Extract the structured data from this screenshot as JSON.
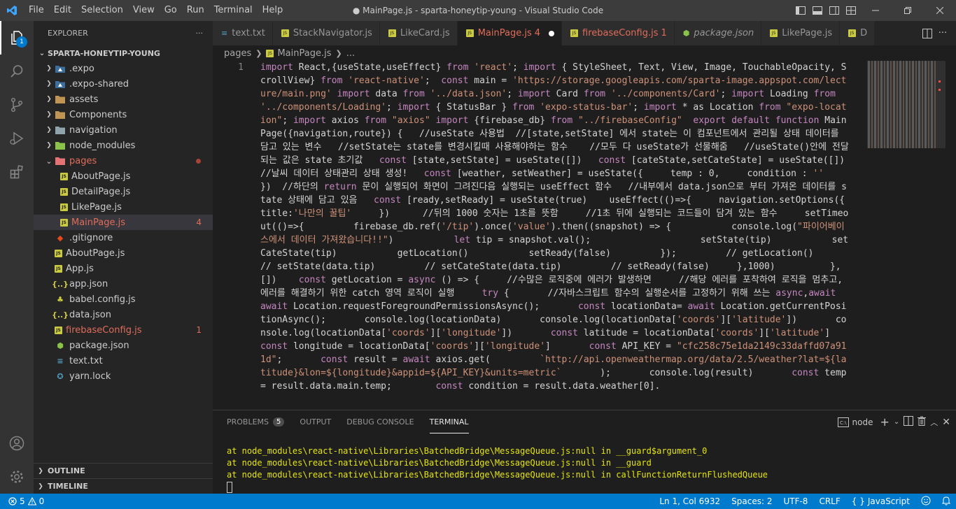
{
  "titlebar": {
    "menu": [
      "File",
      "Edit",
      "Selection",
      "View",
      "Go",
      "Run",
      "Terminal",
      "Help"
    ],
    "title": "● MainPage.js - sparta-honeytip-young - Visual Studio Code"
  },
  "activity": {
    "explorer_badge": "1"
  },
  "sidebar": {
    "header": "EXPLORER",
    "more": "···",
    "project": "SPARTA-HONEYTIP-YOUNG",
    "tree": [
      {
        "label": ".expo",
        "type": "folder",
        "depth": 1,
        "icon": "expo-folder-icon"
      },
      {
        "label": ".expo-shared",
        "type": "folder",
        "depth": 1,
        "icon": "expo-folder-icon"
      },
      {
        "label": "assets",
        "type": "folder",
        "depth": 1,
        "icon": "folder-icon"
      },
      {
        "label": "Components",
        "type": "folder",
        "depth": 1,
        "icon": "folder-icon"
      },
      {
        "label": "navigation",
        "type": "folder",
        "depth": 1,
        "icon": "folder-icon"
      },
      {
        "label": "node_modules",
        "type": "folder",
        "depth": 1,
        "icon": "folder-icon"
      },
      {
        "label": "pages",
        "type": "folder-open",
        "depth": 1,
        "icon": "folder-icon",
        "color": "#e06c5a",
        "dot": true
      },
      {
        "label": "AboutPage.js",
        "type": "js",
        "depth": 2
      },
      {
        "label": "DetailPage.js",
        "type": "js",
        "depth": 2
      },
      {
        "label": "LikePage.js",
        "type": "js",
        "depth": 2
      },
      {
        "label": "MainPage.js",
        "type": "js",
        "depth": 2,
        "color": "#e06c5a",
        "badge": "4",
        "selected": true
      },
      {
        "label": ".gitignore",
        "type": "git",
        "depth": 1
      },
      {
        "label": "AboutPage.js",
        "type": "js",
        "depth": 1
      },
      {
        "label": "App.js",
        "type": "js",
        "depth": 1
      },
      {
        "label": "app.json",
        "type": "json",
        "depth": 1
      },
      {
        "label": "babel.config.js",
        "type": "babel",
        "depth": 1
      },
      {
        "label": "data.json",
        "type": "json",
        "depth": 1
      },
      {
        "label": "firebaseConfig.js",
        "type": "js",
        "depth": 1,
        "color": "#e06c5a",
        "badge": "1"
      },
      {
        "label": "package.json",
        "type": "node",
        "depth": 1
      },
      {
        "label": "text.txt",
        "type": "txt",
        "depth": 1
      },
      {
        "label": "yarn.lock",
        "type": "yarn",
        "depth": 1
      }
    ],
    "outline": "OUTLINE",
    "timeline": "TIMELINE"
  },
  "tabs": [
    {
      "label": "text.txt",
      "icon": "txt",
      "suffix": ""
    },
    {
      "label": "StackNavigator.js",
      "icon": "js",
      "suffix": ""
    },
    {
      "label": "LikeCard.js",
      "icon": "js",
      "suffix": ""
    },
    {
      "label": "MainPage.js",
      "icon": "js",
      "suffix": "4",
      "active": true,
      "color": "#e06c5a"
    },
    {
      "label": "firebaseConfig.js",
      "icon": "js",
      "suffix": "1",
      "color": "#e06c5a"
    },
    {
      "label": "package.json",
      "icon": "node",
      "suffix": "",
      "italic": true
    },
    {
      "label": "LikePage.js",
      "icon": "js",
      "suffix": ""
    },
    {
      "label": "D",
      "icon": "js",
      "suffix": ""
    }
  ],
  "breadcrumb": {
    "folder": "pages",
    "file": "MainPage.js",
    "tail": "..."
  },
  "editor": {
    "line_number": "1",
    "code": "import React,{useState,useEffect} from 'react'; import { StyleSheet, Text, View, Image, TouchableOpacity, ScrollView} from 'react-native';  const main = 'https://storage.googleapis.com/sparta-image.appspot.com/lecture/main.png' import data from '../data.json'; import Card from '../components/Card'; import Loading from '../components/Loading'; import { StatusBar } from 'expo-status-bar'; import * as Location from \"expo-location\"; import axios from \"axios\" import {firebase_db} from \"../firebaseConfig\"  export default function MainPage({navigation,route}) {   //useState 사용법  //[state,setState] 에서 state는 이 컴포넌트에서 관리될 상태 데이터를 담고 있는 변수   //setState는 state를 변경시킬때 사용해야하는 함수    //모두 다 useState가 선물해줌   //useState()안에 전달되는 값은 state 초기값   const [state,setState] = useState([])   const [cateState,setCateState] = useState([])   //날씨 데이터 상태관리 상태 생성!   const [weather, setWeather] = useState({     temp : 0,     condition : ''   })  //하단의 return 문이 실행되어 화면이 그려진다음 실행되는 useEffect 함수   //내부에서 data.json으로 부터 가져온 데이터를 state 상태에 담고 있음   const [ready,setReady] = useState(true)    useEffect(()=>{     navigation.setOptions({       title:'나만의 꿀팁'     })      //뒤의 1000 숫자는 1초를 뜻함     //1초 뒤에 실행되는 코드들이 담겨 있는 함수     setTimeout(()=>{         firebase_db.ref('/tip').once('value').then((snapshot) => {           console.log(\"파이어베이스에서 데이터 가져왔습니다!!\")           let tip = snapshot.val();                    setState(tip)           setCateState(tip)           getLocation()           setReady(false)         });         // getLocation()         // setState(data.tip)         // setCateState(data.tip)         // setReady(false)     },1000)          },[])    const getLocation = async () => {     //수많은 로직중에 에러가 발생하면     //해당 에러를 포착하여 로직을 멈추고,에러를 해결하기 위한 catch 영역 로직이 실행     try {       //자바스크립트 함수의 실행순서를 고정하기 위해 쓰는 async,await       await Location.requestForegroundPermissionsAsync();       const locationData= await Location.getCurrentPositionAsync();       console.log(locationData)       console.log(locationData['coords']['latitude'])       console.log(locationData['coords']['longitude'])       const latitude = locationData['coords']['latitude']       const longitude = locationData['coords']['longitude']       const API_KEY = \"cfc258c75e1da2149c33daffd07a911d\";       const result = await axios.get(         `http://api.openweathermap.org/data/2.5/weather?lat=${latitude}&lon=${longitude}&appid=${API_KEY}&units=metric`       );       console.log(result)       const temp = result.data.main.temp;        const condition = result.data.weather[0]."
  },
  "panel": {
    "tabs": [
      {
        "label": "PROBLEMS",
        "count": "5"
      },
      {
        "label": "OUTPUT"
      },
      {
        "label": "DEBUG CONSOLE"
      },
      {
        "label": "TERMINAL",
        "active": true
      }
    ],
    "terminal_select": "node",
    "terminal_lines": [
      "at node_modules\\react-native\\Libraries\\BatchedBridge\\MessageQueue.js:null in __guard$argument_0",
      "at node_modules\\react-native\\Libraries\\BatchedBridge\\MessageQueue.js:null in __guard",
      "at node_modules\\react-native\\Libraries\\BatchedBridge\\MessageQueue.js:null in callFunctionReturnFlushedQueue"
    ]
  },
  "statusbar": {
    "errors": "5",
    "warnings": "0",
    "position": "Ln 1, Col 6932",
    "spaces": "Spaces: 2",
    "encoding": "UTF-8",
    "eol": "CRLF",
    "language": "JavaScript"
  },
  "colors": {
    "accent": "#007acc",
    "error": "#e06c5a",
    "terminal_text": "#e5e510"
  }
}
